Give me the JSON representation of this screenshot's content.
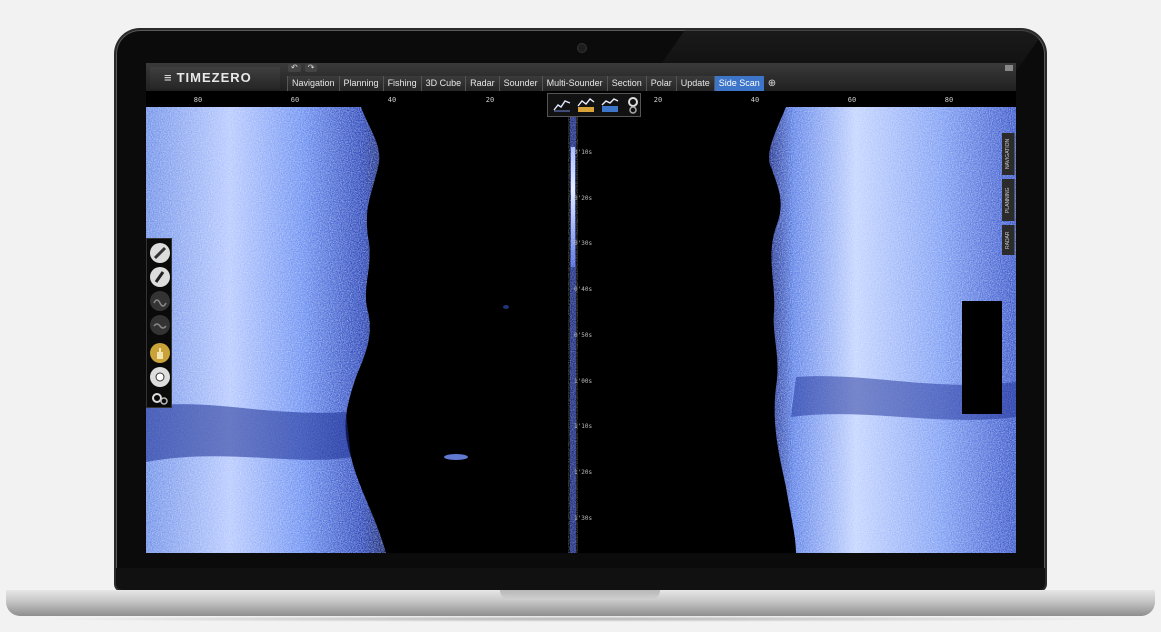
{
  "app": {
    "logo_text": "TIMEZERO",
    "menu_icon": "hamburger-menu-icon",
    "undo_glyph": "↶",
    "redo_glyph": "↷"
  },
  "tabs": [
    {
      "label": "Navigation",
      "active": false
    },
    {
      "label": "Planning",
      "active": false
    },
    {
      "label": "Fishing",
      "active": false
    },
    {
      "label": "3D Cube",
      "active": false
    },
    {
      "label": "Radar",
      "active": false
    },
    {
      "label": "Sounder",
      "active": false
    },
    {
      "label": "Multi-Sounder",
      "active": false
    },
    {
      "label": "Section",
      "active": false
    },
    {
      "label": "Polar",
      "active": false
    },
    {
      "label": "Update",
      "active": false
    },
    {
      "label": "Side Scan",
      "active": true
    }
  ],
  "add_tab_glyph": "⊕",
  "ruler": {
    "ticks": [
      "80",
      "60",
      "40",
      "20",
      "20",
      "40",
      "60",
      "80"
    ]
  },
  "depth_labels": [
    "0'10s",
    "0'20s",
    "0'30s",
    "0'40s",
    "0'50s",
    "1'00s",
    "1'10s",
    "1'20s",
    "1'30s"
  ],
  "right_rail": [
    "NAVIGATION",
    "PLANNING",
    "RADAR"
  ],
  "tool_popup_icons": [
    "sonar-line-icon",
    "depth-chart-icon",
    "side-scan-chart-icon",
    "settings-gears-icon"
  ],
  "left_toolbar_icons": [
    "pencil-icon",
    "pen-icon",
    "wave-icon",
    "wave-icon-2",
    "hand-icon",
    "record-icon",
    "settings-gears-icon"
  ],
  "colors": {
    "accent_tab": "#3d76c8",
    "sonar_light": "#c9d8ff",
    "sonar_mid": "#4b6fd9",
    "sonar_dark": "#1a2b8a"
  }
}
